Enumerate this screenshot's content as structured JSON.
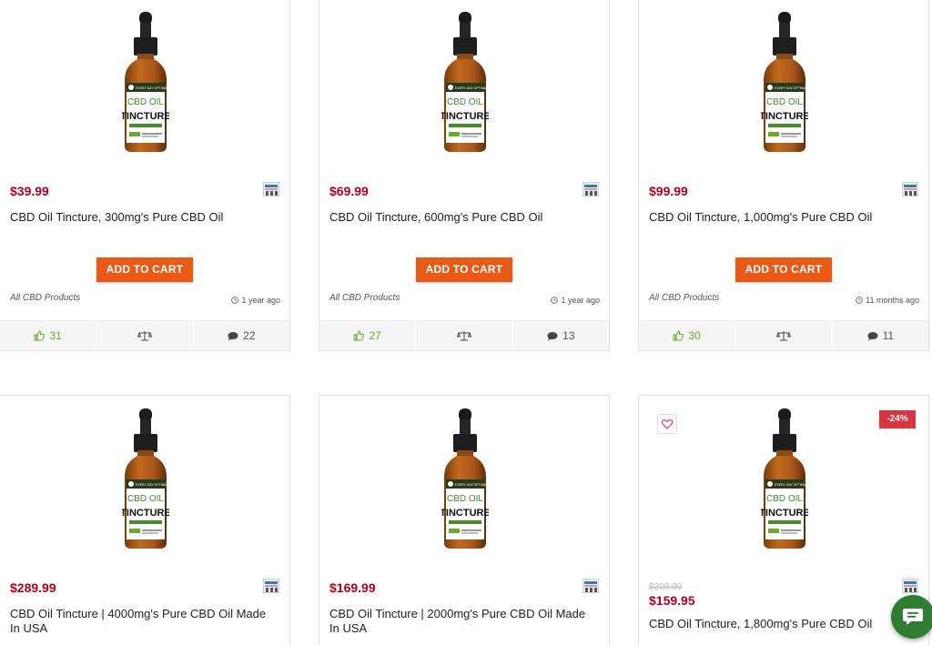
{
  "products": [
    {
      "price": "$39.99",
      "title": "CBD Oil Tincture, 300mg's Pure CBD Oil",
      "button": "ADD TO CART",
      "category": "All CBD Products",
      "time": "1 year ago",
      "likes": "31",
      "comments": "22"
    },
    {
      "price": "$69.99",
      "title": "CBD Oil Tincture, 600mg's Pure CBD Oil",
      "button": "ADD TO CART",
      "category": "All CBD Products",
      "time": "1 year ago",
      "likes": "27",
      "comments": "13"
    },
    {
      "price": "$99.99",
      "title": "CBD Oil Tincture, 1,000mg's Pure CBD Oil",
      "button": "ADD TO CART",
      "category": "All CBD Products",
      "time": "11 months ago",
      "likes": "30",
      "comments": "11"
    },
    {
      "price": "$289.99",
      "title": "CBD Oil Tincture | 4000mg's Pure CBD Oil Made In USA"
    },
    {
      "price": "$169.99",
      "title": "CBD Oil Tincture | 2000mg's Pure CBD Oil Made In USA"
    },
    {
      "old_price": "$209.99",
      "price": "$159.95",
      "title": "CBD Oil Tincture, 1,800mg's Pure CBD Oil",
      "discount": "-24%"
    }
  ],
  "bottle_label": {
    "brand": "EVERY DAY OPTIMAL",
    "line1": "CBD OIL",
    "line2": "TINCTURE"
  },
  "colors": {
    "price": "#b3001b",
    "button": "#ea5a17",
    "likes": "#6aaa2a",
    "badge": "#d9343f",
    "chat": "#2e7d32"
  },
  "icons": [
    "store-icon",
    "clock-icon",
    "thumbs-up-icon",
    "compare-scale-icon",
    "comment-icon",
    "heart-icon",
    "chat-icon"
  ]
}
